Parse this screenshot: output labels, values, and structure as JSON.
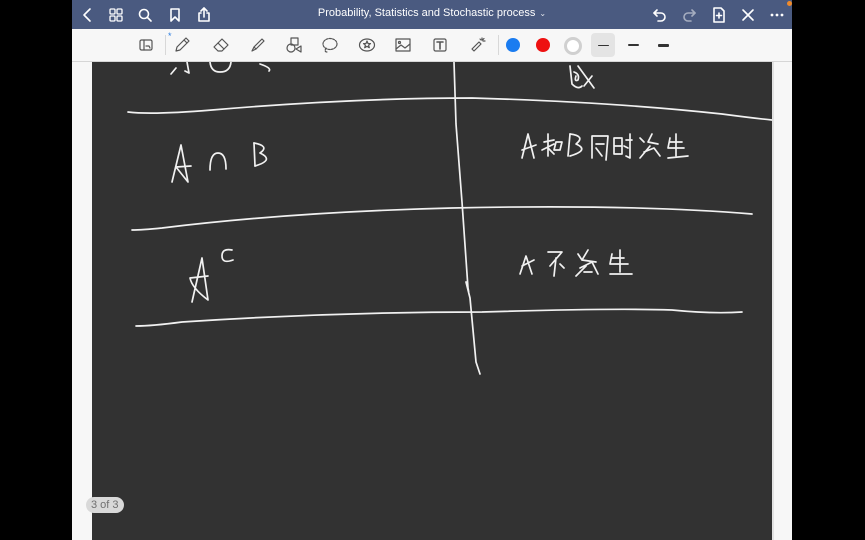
{
  "window": {
    "title": "Probability, Statistics and Stochastic process",
    "title_caret": "⌄",
    "left_icons": [
      "back-icon",
      "thumbnails-grid-icon",
      "search-icon",
      "bookmark-icon",
      "share-icon"
    ],
    "right_icons": [
      "undo-icon",
      "redo-icon",
      "add-page-icon",
      "close-icon",
      "more-icon"
    ],
    "notification_color": "#f08a2a"
  },
  "toolbar": {
    "tools": [
      "read-mode-icon",
      "pen-icon",
      "eraser-icon",
      "highlighter-icon",
      "shapes-icon",
      "lasso-icon",
      "sticker-icon",
      "image-icon",
      "text-icon",
      "laser-pointer-icon"
    ],
    "bluetooth_mark": "*",
    "colors": [
      {
        "name": "blue",
        "hex": "#1a7cf0"
      },
      {
        "name": "red",
        "hex": "#ee1111"
      },
      {
        "name": "white",
        "hex": "#ffffff",
        "selected": true
      }
    ],
    "stroke_widths": [
      "thin",
      "medium",
      "thick"
    ],
    "selected_stroke": "thin"
  },
  "page": {
    "background": "#323232",
    "ink_color": "#f1f1f1",
    "handwritten_table": [
      {
        "symbol": "A ∪ B",
        "meaning": "或"
      },
      {
        "symbol": "A ∩ B",
        "meaning": "A和B同时发生"
      },
      {
        "symbol": "Aᶜ",
        "meaning": "A不发生"
      }
    ],
    "indicator": "3 of 3"
  }
}
